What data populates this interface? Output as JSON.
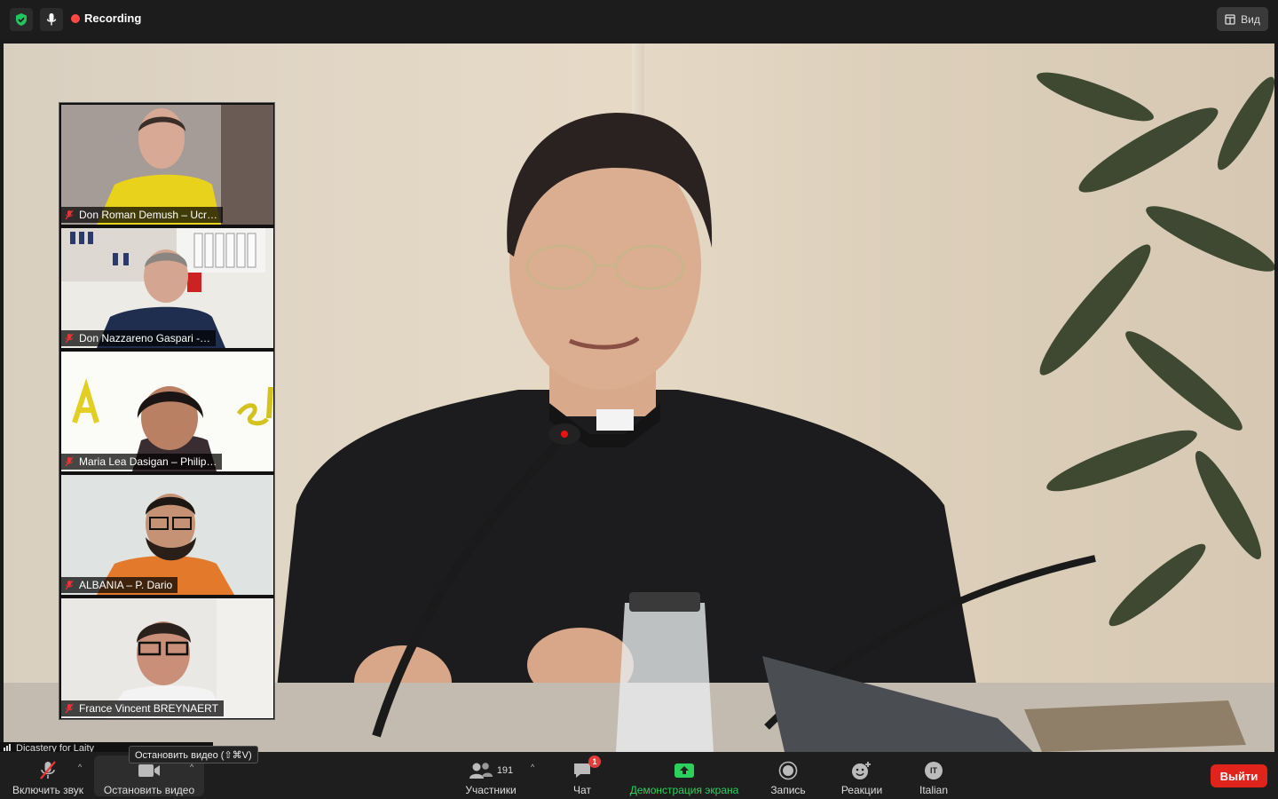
{
  "topbar": {
    "recording_label": "Recording",
    "view_label": "Вид"
  },
  "participants_thumbs": [
    {
      "name": "Don Roman Demush – Ucr…",
      "muted": true
    },
    {
      "name": "Don Nazzareno Gaspari -…",
      "muted": true
    },
    {
      "name": "Maria Lea Dasigan – Philip…",
      "muted": true
    },
    {
      "name": "ALBANIA – P. Dario",
      "muted": true
    },
    {
      "name": "France Vincent BREYNAERT",
      "muted": true
    }
  ],
  "self_label": "Dicastery for Laity",
  "tooltip": "Остановить видео (⇧⌘V)",
  "toolbar": {
    "unmute_label": "Включить звук",
    "stop_video_label": "Остановить видео",
    "participants_count": "191",
    "participants_label": "Участники",
    "chat_label": "Чат",
    "chat_badge": "1",
    "share_label": "Демонстрация экрана",
    "record_label": "Запись",
    "reactions_label": "Реакции",
    "interpretation_badge": "IT",
    "interpretation_label": "Italian",
    "exit_label": "Выйти"
  },
  "colors": {
    "accent_green": "#2bd15c",
    "exit_red": "#e0241c",
    "recording_red": "#ff4a42"
  }
}
